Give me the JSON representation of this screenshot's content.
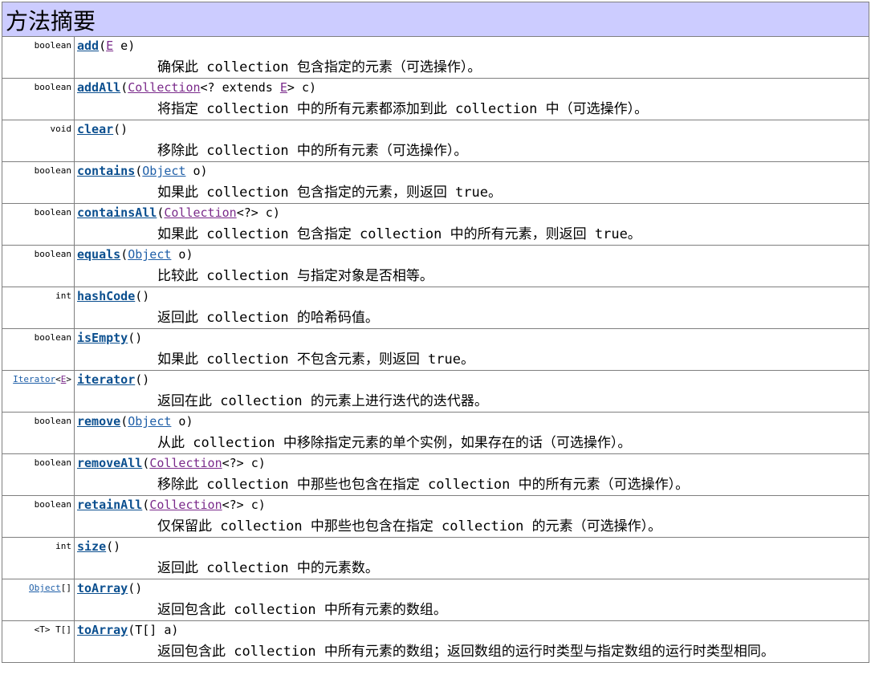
{
  "header": {
    "title": "方法摘要"
  },
  "methods": [
    {
      "ret": "boolean",
      "name": "add",
      "params": [
        {
          "t": "("
        },
        {
          "t": "E",
          "link": "purple"
        },
        {
          "t": " e)"
        }
      ],
      "desc": "确保此 collection 包含指定的元素（可选操作）。"
    },
    {
      "ret": "boolean",
      "name": "addAll",
      "params": [
        {
          "t": "("
        },
        {
          "t": "Collection",
          "link": "purple"
        },
        {
          "t": "<? extends "
        },
        {
          "t": "E",
          "link": "purple"
        },
        {
          "t": "> c)"
        }
      ],
      "desc": "将指定 collection 中的所有元素都添加到此 collection 中（可选操作）。"
    },
    {
      "ret": "void",
      "name": "clear",
      "params": [
        {
          "t": "()"
        }
      ],
      "desc": "移除此 collection 中的所有元素（可选操作）。"
    },
    {
      "ret": "boolean",
      "name": "contains",
      "params": [
        {
          "t": "("
        },
        {
          "t": "Object",
          "link": "blue"
        },
        {
          "t": " o)"
        }
      ],
      "desc": "如果此 collection 包含指定的元素，则返回 true。"
    },
    {
      "ret": "boolean",
      "name": "containsAll",
      "params": [
        {
          "t": "("
        },
        {
          "t": "Collection",
          "link": "purple"
        },
        {
          "t": "<?> c)"
        }
      ],
      "desc": "如果此 collection 包含指定 collection 中的所有元素，则返回 true。"
    },
    {
      "ret": "boolean",
      "name": "equals",
      "params": [
        {
          "t": "("
        },
        {
          "t": "Object",
          "link": "blue"
        },
        {
          "t": " o)"
        }
      ],
      "desc": "比较此 collection 与指定对象是否相等。"
    },
    {
      "ret": "int",
      "name": "hashCode",
      "params": [
        {
          "t": "()"
        }
      ],
      "desc": "返回此 collection 的哈希码值。"
    },
    {
      "ret": "boolean",
      "name": "isEmpty",
      "params": [
        {
          "t": "()"
        }
      ],
      "desc": "如果此 collection 不包含元素，则返回 true。"
    },
    {
      "ret": "Iterator<E>",
      "retParts": [
        {
          "t": "Iterator",
          "link": "blue"
        },
        {
          "t": "<"
        },
        {
          "t": "E",
          "link": "purple"
        },
        {
          "t": ">"
        }
      ],
      "name": "iterator",
      "params": [
        {
          "t": "()"
        }
      ],
      "desc": "返回在此 collection 的元素上进行迭代的迭代器。"
    },
    {
      "ret": "boolean",
      "name": "remove",
      "params": [
        {
          "t": "("
        },
        {
          "t": "Object",
          "link": "blue"
        },
        {
          "t": " o)"
        }
      ],
      "desc": "从此 collection 中移除指定元素的单个实例，如果存在的话（可选操作）。"
    },
    {
      "ret": "boolean",
      "name": "removeAll",
      "params": [
        {
          "t": "("
        },
        {
          "t": "Collection",
          "link": "purple"
        },
        {
          "t": "<?> c)"
        }
      ],
      "desc": "移除此 collection 中那些也包含在指定 collection 中的所有元素（可选操作）。"
    },
    {
      "ret": "boolean",
      "name": "retainAll",
      "params": [
        {
          "t": "("
        },
        {
          "t": "Collection",
          "link": "purple"
        },
        {
          "t": "<?> c)"
        }
      ],
      "desc": "仅保留此 collection 中那些也包含在指定 collection 的元素（可选操作）。"
    },
    {
      "ret": "int",
      "name": "size",
      "params": [
        {
          "t": "()"
        }
      ],
      "desc": "返回此 collection 中的元素数。"
    },
    {
      "ret": "Object[]",
      "retParts": [
        {
          "t": "Object",
          "link": "blue"
        },
        {
          "t": "[]"
        }
      ],
      "name": "toArray",
      "params": [
        {
          "t": "()"
        }
      ],
      "desc": "返回包含此 collection 中所有元素的数组。"
    },
    {
      "ret": "<T> T[]",
      "name": "toArray",
      "params": [
        {
          "t": "(T[] a)"
        }
      ],
      "desc": "返回包含此 collection 中所有元素的数组；返回数组的运行时类型与指定数组的运行时类型相同。"
    }
  ]
}
